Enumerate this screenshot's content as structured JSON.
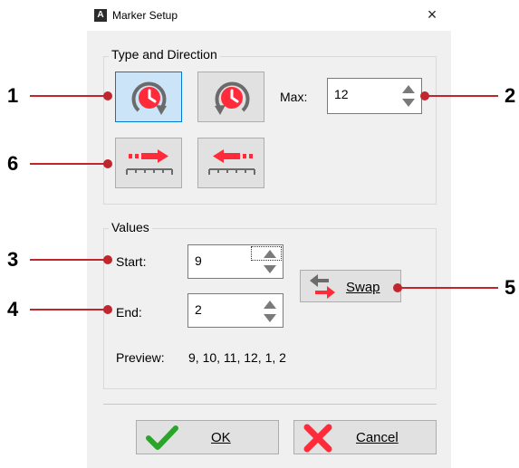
{
  "window": {
    "app_icon_letter": "A",
    "title": "Marker Setup",
    "close_glyph": "×"
  },
  "type_direction": {
    "group_label": "Type and Direction",
    "max_label": "Max:",
    "max_value": "12"
  },
  "values": {
    "group_label": "Values",
    "start_label": "Start:",
    "start_value": "9",
    "end_label": "End:",
    "end_value": "2",
    "swap_label": "Swap",
    "preview_label": "Preview:",
    "preview_value": "9, 10, 11, 12, 1, 2"
  },
  "footer": {
    "ok_label": "OK",
    "cancel_label": "Cancel"
  },
  "callouts": [
    "1",
    "2",
    "3",
    "4",
    "5",
    "6"
  ],
  "colors": {
    "accent_red": "#ff2b3a",
    "callout_red": "#c0262d",
    "selected_bg": "#cce4f7",
    "ok_green": "#2aa52a"
  }
}
